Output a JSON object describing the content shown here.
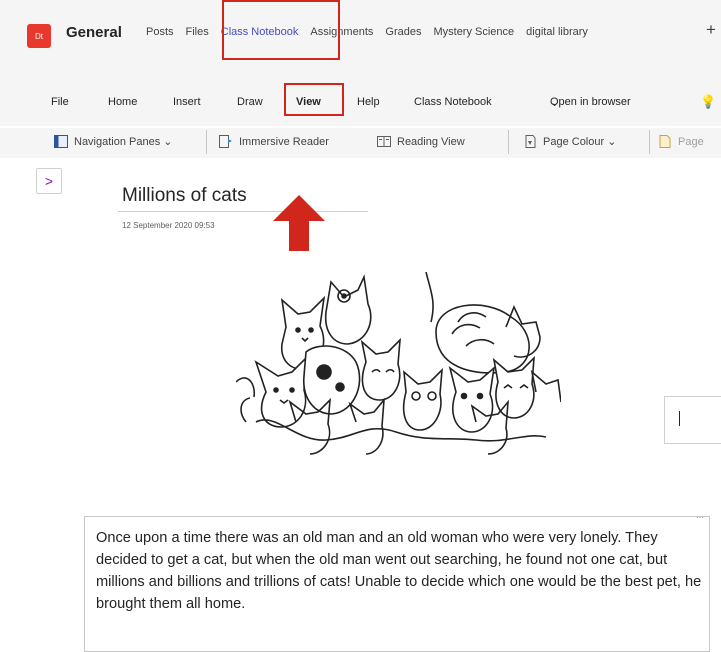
{
  "header": {
    "team_badge": "Dt",
    "channel": "General",
    "tabs": [
      "Posts",
      "Files",
      "Class Notebook",
      "Assignments",
      "Grades",
      "Mystery Science",
      "digital library"
    ],
    "active_tab": "Class Notebook",
    "add_tab": "+"
  },
  "menu": {
    "items": [
      "File",
      "Home",
      "Insert",
      "Draw",
      "View",
      "Help",
      "Class Notebook"
    ],
    "active": "View",
    "open_in_browser": "Open in browser",
    "lightbulb": "lightbulb-icon"
  },
  "ribbon": {
    "navigation_panes": "Navigation Panes",
    "immersive_reader": "Immersive Reader",
    "reading_view": "Reading View",
    "page_colour": "Page Colour",
    "page_cut": "Page"
  },
  "page": {
    "title": "Millions of cats",
    "date": "12 September 2020   09:53",
    "story": "Once upon a time there was an old man and an old woman who were very lonely. They decided to get a cat, but when the old man went out searching, he found not one cat, but millions and billions and trillions of cats! Unable to decide which one would be the best pet, he brought them all home."
  },
  "colors": {
    "highlight": "#d0261c",
    "active_tab": "#464eb8",
    "badge": "#e8372c"
  }
}
